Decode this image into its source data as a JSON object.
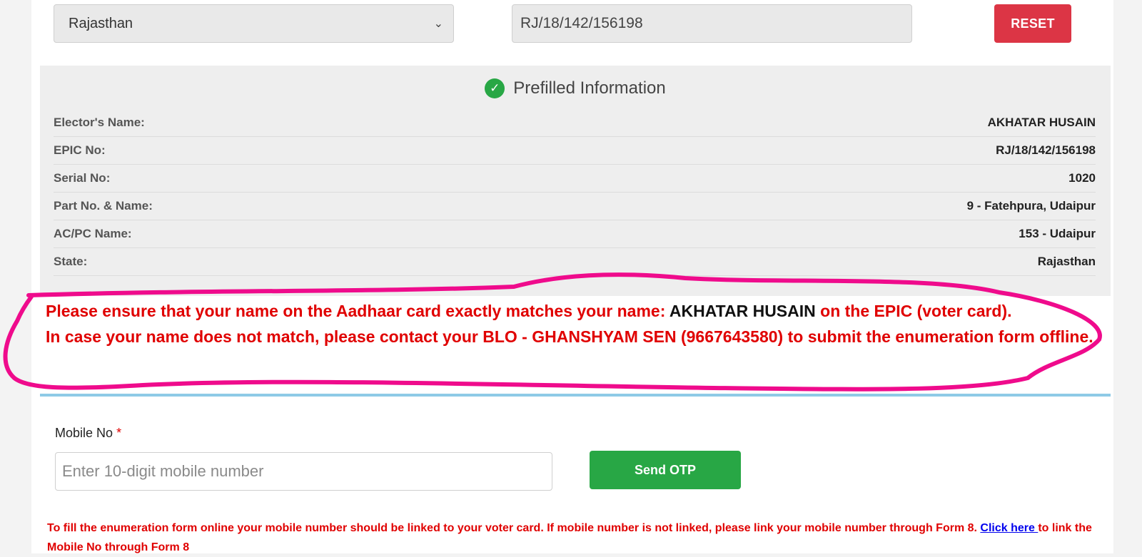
{
  "top": {
    "state_value": "Rajasthan",
    "epic_value": "RJ/18/142/156198",
    "reset_label": "RESET"
  },
  "prefill": {
    "title": "Prefilled Information",
    "rows": [
      {
        "label": "Elector's Name:",
        "value": "AKHATAR HUSAIN"
      },
      {
        "label": "EPIC No:",
        "value": "RJ/18/142/156198"
      },
      {
        "label": "Serial No:",
        "value": "1020"
      },
      {
        "label": "Part No. & Name:",
        "value": "9 - Fatehpura, Udaipur"
      },
      {
        "label": "AC/PC Name:",
        "value": "153 - Udaipur"
      },
      {
        "label": "State:",
        "value": "Rajasthan"
      }
    ]
  },
  "warning": {
    "line1_pre": "Please ensure that your name on the Aadhaar card exactly matches your name: ",
    "line1_name": "AKHATAR HUSAIN",
    "line1_post": " on the EPIC (voter card).",
    "line2": "In case your name does not match, please contact your BLO - GHANSHYAM SEN (9667643580) to submit the enumeration form offline."
  },
  "mobile": {
    "label": "Mobile No",
    "required_mark": "*",
    "placeholder": "Enter 10-digit mobile number",
    "send_otp_label": "Send OTP"
  },
  "footer": {
    "text_pre": "To fill the enumeration form online your mobile number should be linked to your voter card. If mobile number is not linked, please link your mobile number through Form 8. ",
    "link_text": "Click here ",
    "text_post": "to link the Mobile No through Form 8"
  },
  "colors": {
    "reset": "#dc3545",
    "success": "#28a745",
    "warning_text": "#e00000",
    "highlight_stroke": "#ef0b8c",
    "rule": "#8ecae6"
  },
  "icons": {
    "select_caret": "chevron-down-icon",
    "prefill_title": "check-circle-icon"
  }
}
